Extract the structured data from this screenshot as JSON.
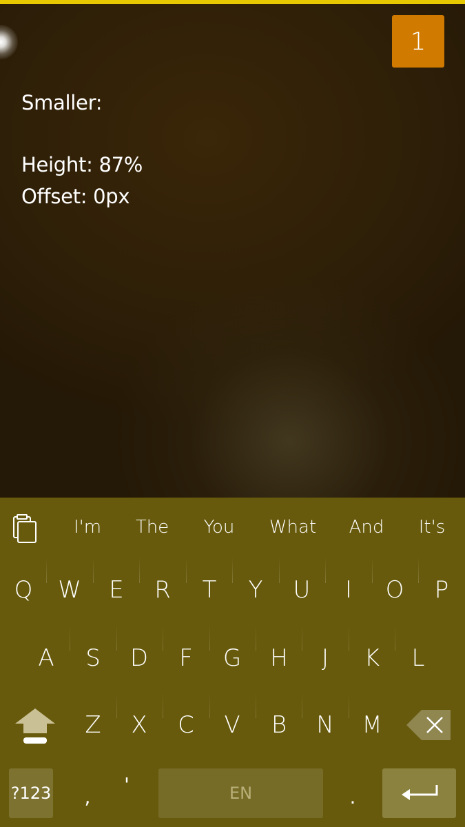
{
  "badge": {
    "count": "1"
  },
  "info": {
    "title": "Smaller:",
    "height_line": "Height: 87%",
    "offset_line": "Offset: 0px"
  },
  "keyboard": {
    "suggestions": [
      "I'm",
      "The",
      "You",
      "What",
      "And",
      "It's"
    ],
    "row1": [
      "Q",
      "W",
      "E",
      "R",
      "T",
      "Y",
      "U",
      "I",
      "O",
      "P"
    ],
    "row2": [
      "A",
      "S",
      "D",
      "F",
      "G",
      "H",
      "J",
      "K",
      "L"
    ],
    "row3": [
      "Z",
      "X",
      "C",
      "V",
      "B",
      "N",
      "M"
    ],
    "symbols_label": "?123",
    "comma_label": ",",
    "apostrophe_label": "'",
    "space_label": "EN",
    "period_label": ".",
    "icons": {
      "clipboard": "clipboard-icon",
      "shift": "shift-icon",
      "backspace": "backspace-icon",
      "enter": "enter-icon"
    }
  },
  "colors": {
    "top_bar": "#e8c800",
    "badge": "#d17a00",
    "keyboard_bg": "#675a0c"
  }
}
